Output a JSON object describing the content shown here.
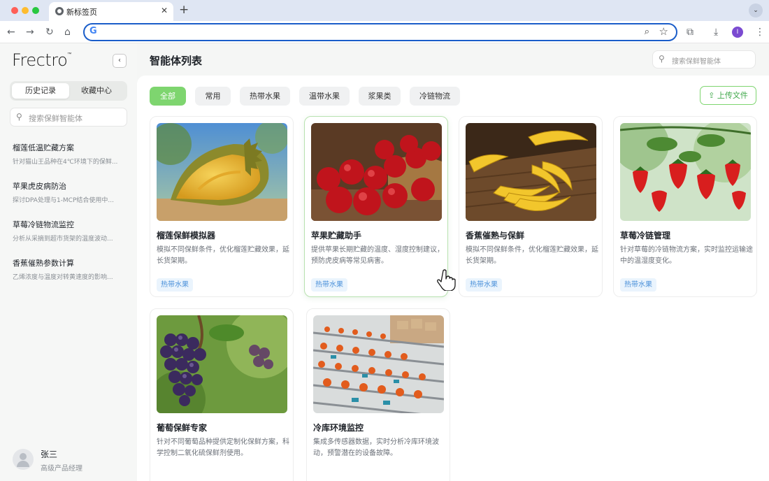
{
  "browser": {
    "tab_title": "新标签页",
    "tab_close": "✕",
    "new_tab": "+",
    "tab_menu": "⌄",
    "address_value": "",
    "google_glyph": "G",
    "profile_initial": "I",
    "icons": [
      "back-icon",
      "forward-icon",
      "reload-icon",
      "home-icon",
      "zoom-icon",
      "star-icon",
      "extensions-icon",
      "download-icon",
      "menu-icon"
    ]
  },
  "sidebar": {
    "logo": "Frectro",
    "logo_mark": "™",
    "collapse": "‹",
    "segments": [
      "历史记录",
      "收藏中心"
    ],
    "active_segment": 0,
    "search_placeholder": "搜索保鲜智能体",
    "history": [
      {
        "title": "榴莲低温贮藏方案",
        "desc": "针对猫山王品种在4℃环境下的保鲜..."
      },
      {
        "title": "苹果虎皮病防治",
        "desc": "探讨DPA处理与1-MCP结合使用中..."
      },
      {
        "title": "草莓冷链物流监控",
        "desc": "分析从采摘到超市货架的温度波动..."
      },
      {
        "title": "香蕉催熟参数计算",
        "desc": "乙烯浓度与温度对转黄速度的影响..."
      }
    ],
    "user": {
      "name": "张三",
      "role": "高级产品经理"
    }
  },
  "main": {
    "title": "智能体列表",
    "search_placeholder": "搜索保鲜智能体",
    "filters": [
      "全部",
      "常用",
      "热带水果",
      "温带水果",
      "浆果类",
      "冷链物流"
    ],
    "active_filter": 0,
    "upload_label": "上传文件",
    "cards": [
      {
        "title": "榴莲保鲜模拟器",
        "desc": "模拟不同保鲜条件，优化榴莲贮藏效果，延长货架期。",
        "tag": "热带水果",
        "image": "durian"
      },
      {
        "title": "苹果贮藏助手",
        "desc": "提供苹果长期贮藏的温度、湿度控制建议，预防虎皮病等常见病害。",
        "tag": "热带水果",
        "image": "apples"
      },
      {
        "title": "香蕉催熟与保鲜",
        "desc": "模拟不同保鲜条件，优化榴莲贮藏效果，延长货架期。",
        "tag": "热带水果",
        "image": "bananas"
      },
      {
        "title": "草莓冷链管理",
        "desc": "针对草莓的冷链物流方案，实时监控运输途中的温湿度变化。",
        "tag": "热带水果",
        "image": "strawberries"
      },
      {
        "title": "葡萄保鲜专家",
        "desc": "针对不同葡萄品种提供定制化保鲜方案，科学控制二氧化硫保鲜剂使用。",
        "image": "grapes"
      },
      {
        "title": "冷库环境监控",
        "desc": "集成多传感器数据，实时分析冷库环境波动，预警潜在的设备故障。",
        "image": "coldstorage"
      }
    ],
    "selected_card": 1
  },
  "colors": {
    "accent": "#7ed56f",
    "accent_text": "#3fa84a",
    "tag_bg": "#eaf4fd",
    "tag_text": "#4a90d9"
  }
}
